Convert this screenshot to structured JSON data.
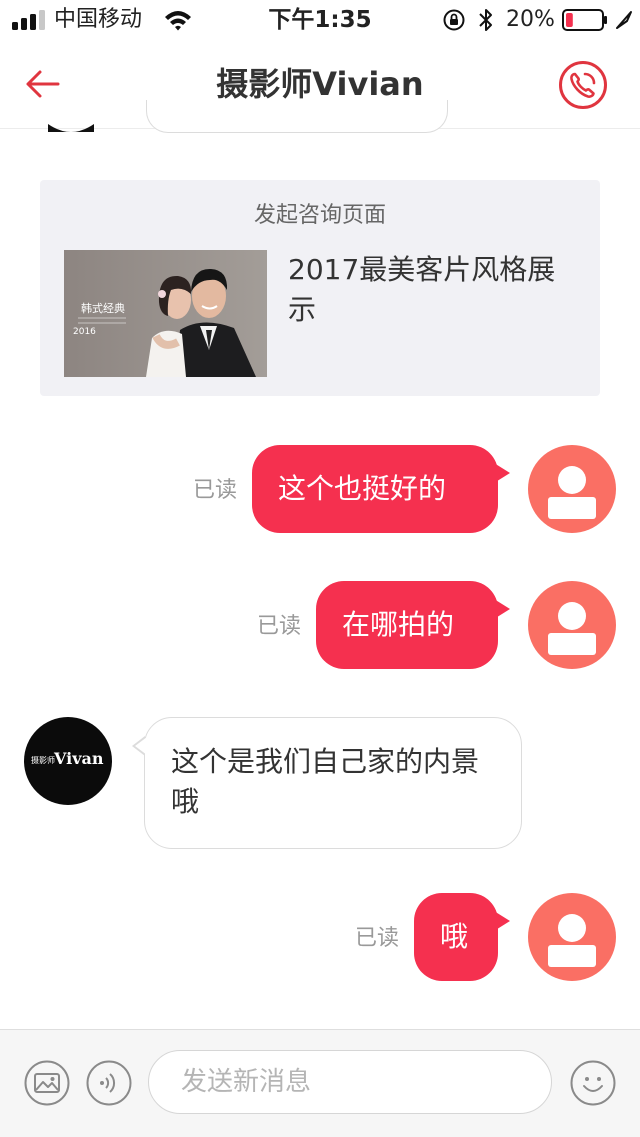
{
  "status_bar": {
    "carrier": "中国移动",
    "time": "下午1:35",
    "battery_percent": "20%",
    "battery_level": 0.2
  },
  "header": {
    "title": "摄影师Vivian"
  },
  "card": {
    "title": "发起咨询页面",
    "text": "2017最美客片风格展示",
    "thumb_caption": "韩式经典",
    "thumb_year": "2016"
  },
  "messages": [
    {
      "from": "me",
      "text": "这个也挺好的",
      "status": "已读"
    },
    {
      "from": "me",
      "text": "在哪拍的",
      "status": "已读"
    },
    {
      "from": "photographer",
      "text": "这个是我们自己家的内景哦",
      "avatar_text_small": "摄影师",
      "avatar_text_large": "Vivan"
    },
    {
      "from": "me",
      "text": "哦",
      "status": "已读"
    }
  ],
  "input_bar": {
    "placeholder": "发送新消息"
  },
  "colors": {
    "accent": "#f5304f",
    "avatar_me": "#fa6f64",
    "icon_red": "#e0353f"
  },
  "icons": [
    "back-arrow-icon",
    "phone-icon",
    "image-icon",
    "voice-icon",
    "emoji-icon",
    "wifi-icon",
    "bluetooth-icon",
    "orientation-lock-icon"
  ]
}
